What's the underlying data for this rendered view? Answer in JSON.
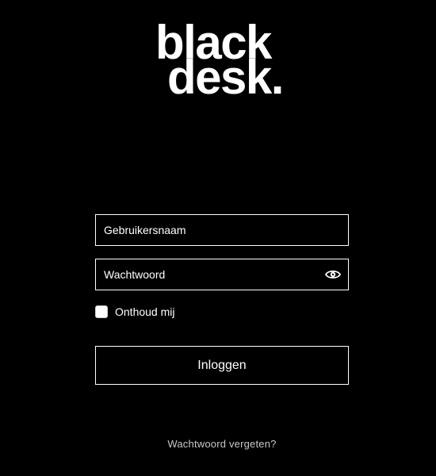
{
  "logo": {
    "line1": "black",
    "line2": "desk."
  },
  "form": {
    "username_placeholder": "Gebruikersnaam",
    "password_placeholder": "Wachtwoord",
    "show_password_icon": "eye-icon",
    "remember_label": "Onthoud mij",
    "remember_checked": false,
    "login_label": "Inloggen",
    "forgot_label": "Wachtwoord vergeten?"
  },
  "colors": {
    "background": "#000000",
    "foreground": "#ffffff",
    "muted_link": "#c8c8c8"
  }
}
